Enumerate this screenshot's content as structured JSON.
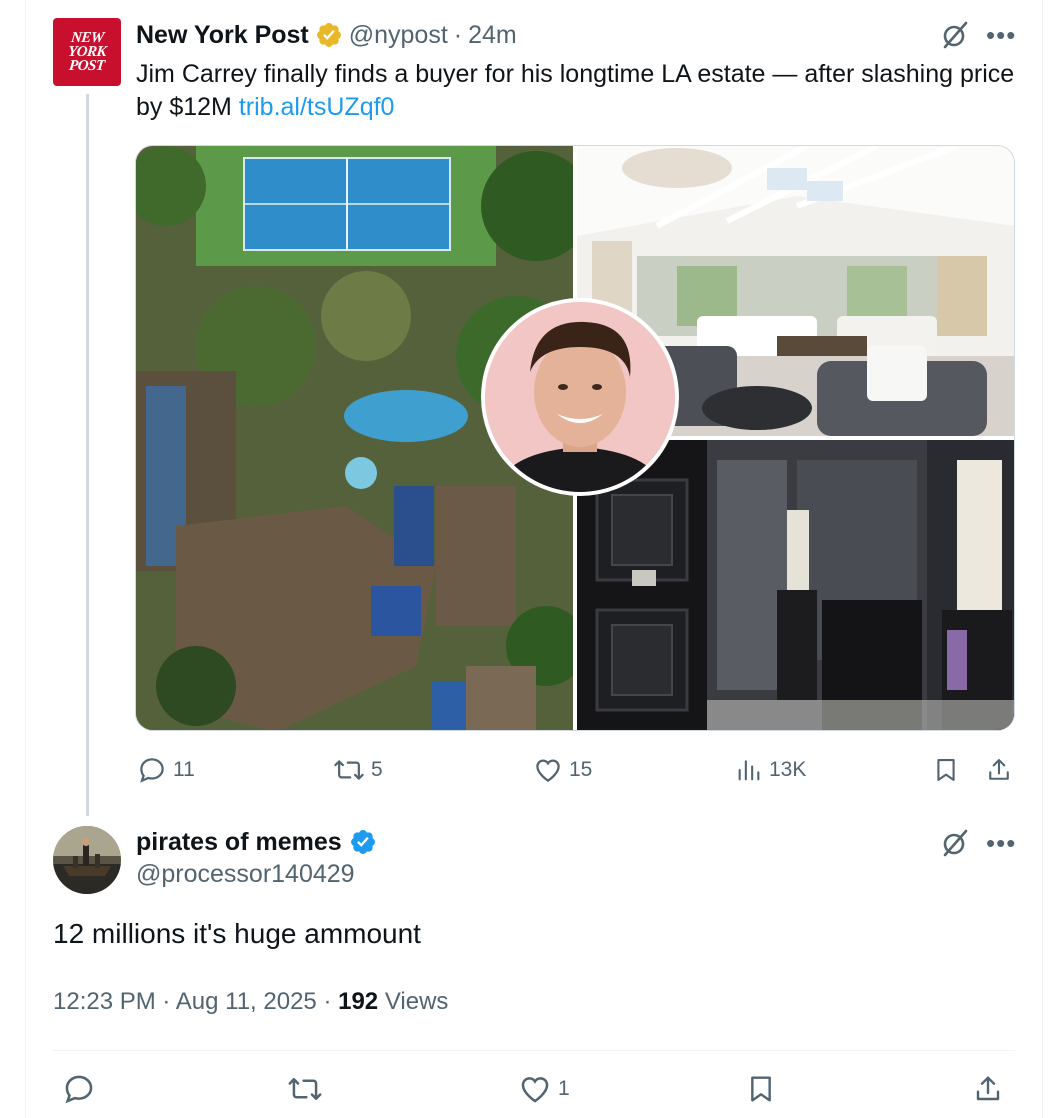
{
  "parent_tweet": {
    "display_name": "New York Post",
    "avatar_text": [
      "NEW",
      "YORK",
      "POST"
    ],
    "handle": "@nypost",
    "separator": "·",
    "time": "24m",
    "text": "Jim Carrey finally finds a buyer for his longtime LA estate — after slashing price by $12M",
    "link": "trib.al/tsUZqf0",
    "badge_color": "#e8b829",
    "actions": {
      "replies": "11",
      "reposts": "5",
      "likes": "15",
      "views": "13K"
    }
  },
  "reply_tweet": {
    "display_name": "pirates of memes",
    "handle": "@processor140429",
    "badge_color": "#1d9bf0",
    "text": "12 millions it's huge ammount",
    "time": "12:23 PM",
    "date": "Aug 11, 2025",
    "separator": "·",
    "views_count": "192",
    "views_label": "Views",
    "actions": {
      "likes": "1"
    }
  },
  "icons": {
    "grok": "grok-icon",
    "more": "more-icon",
    "reply": "reply-icon",
    "repost": "repost-icon",
    "like": "like-icon",
    "views": "views-icon",
    "bookmark": "bookmark-icon",
    "share": "share-icon",
    "verified": "verified-icon"
  },
  "colors": {
    "text": "#0f1419",
    "muted": "#536471",
    "link": "#1d9bf0",
    "nyp_red": "#c8102e"
  }
}
